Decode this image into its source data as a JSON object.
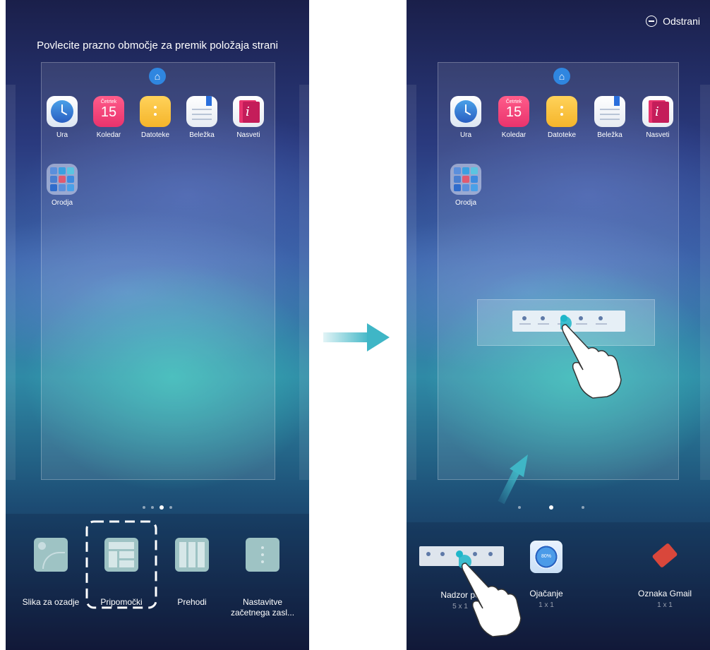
{
  "left": {
    "hint": "Povlecite prazno območje za premik položaja strani",
    "apps": [
      {
        "label": "Ura",
        "icon": "clock-icon"
      },
      {
        "label": "Koledar",
        "icon": "calendar-icon",
        "month": "Četrtek",
        "day": "15"
      },
      {
        "label": "Datoteke",
        "icon": "files-icon"
      },
      {
        "label": "Beležka",
        "icon": "notepad-icon"
      },
      {
        "label": "Nasveti",
        "icon": "tips-icon"
      }
    ],
    "folder": {
      "label": "Orodja",
      "icon": "tools-folder-icon"
    },
    "tray": [
      {
        "label": "Slika za ozadje",
        "icon": "wallpaper-icon"
      },
      {
        "label": "Pripomočki",
        "icon": "widgets-icon"
      },
      {
        "label": "Prehodi",
        "icon": "transitions-icon"
      },
      {
        "label": "Nastavitve",
        "label2": "začetnega zasl...",
        "icon": "settings-icon"
      }
    ],
    "page_indicator": {
      "count": 4,
      "active": 3
    }
  },
  "right": {
    "remove_label": "Odstrani",
    "apps": [
      {
        "label": "Ura",
        "icon": "clock-icon"
      },
      {
        "label": "Koledar",
        "icon": "calendar-icon",
        "month": "Četrtek",
        "day": "15"
      },
      {
        "label": "Datoteke",
        "icon": "files-icon"
      },
      {
        "label": "Beležka",
        "icon": "notepad-icon"
      },
      {
        "label": "Nasveti",
        "icon": "tips-icon"
      }
    ],
    "folder": {
      "label": "Orodja",
      "icon": "tools-folder-icon"
    },
    "widgets": [
      {
        "label": "Nadzor po",
        "size": "5 x 1",
        "icon": "switch-panel-icon"
      },
      {
        "label": "Ojačanje",
        "size": "1 x 1",
        "icon": "booster-icon",
        "value": "80%"
      },
      {
        "label": "Oznaka Gmail",
        "size": "1 x 1",
        "icon": "gmail-label-icon"
      }
    ],
    "page_indicator": {
      "count": 3,
      "active": 2
    }
  },
  "colors": {
    "arrow": "#3fb6c6",
    "accent": "#2f86e0"
  }
}
